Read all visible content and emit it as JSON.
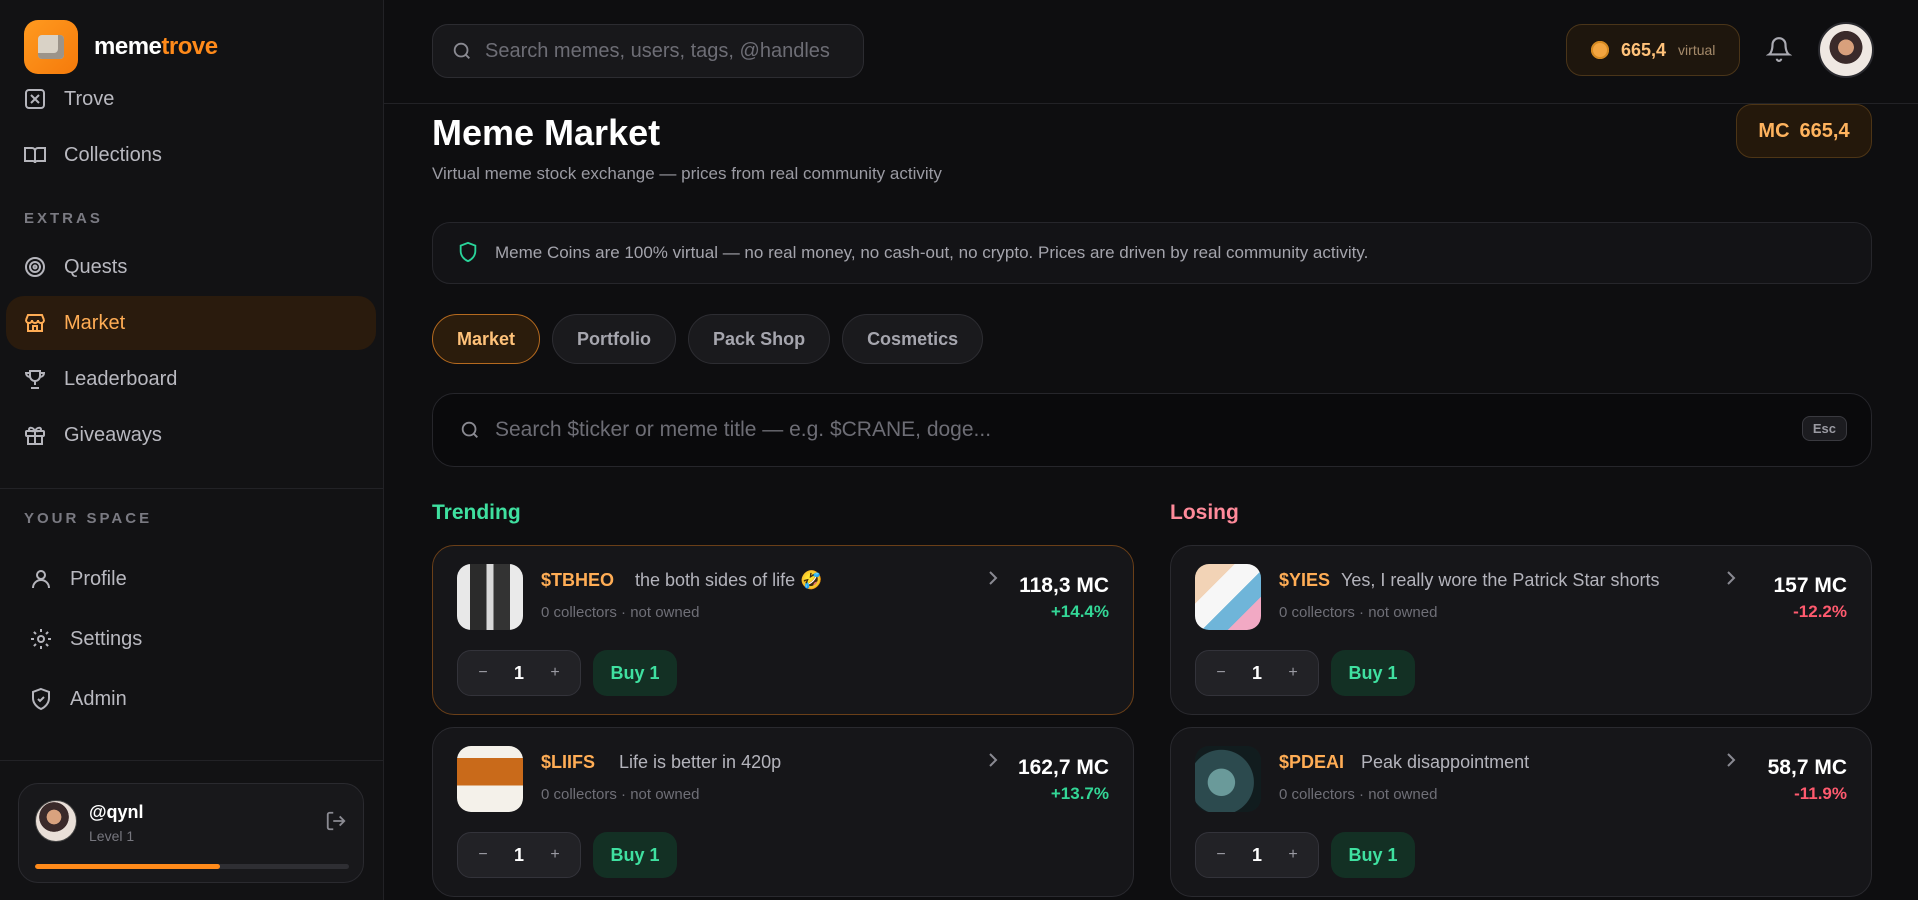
{
  "brand": {
    "name_a": "meme",
    "name_b": "trove"
  },
  "sidebar": {
    "items": [
      {
        "label": "Trove"
      },
      {
        "label": "Collections"
      }
    ],
    "extras_label": "EXTRAS",
    "extras": [
      {
        "label": "Quests"
      },
      {
        "label": "Market"
      },
      {
        "label": "Leaderboard"
      },
      {
        "label": "Giveaways"
      }
    ],
    "space_label": "YOUR SPACE",
    "space": [
      {
        "label": "Profile"
      },
      {
        "label": "Settings"
      },
      {
        "label": "Admin"
      }
    ]
  },
  "user": {
    "handle": "@qynl",
    "level": "Level 1",
    "xp_fraction": 0.59
  },
  "topbar": {
    "search_placeholder": "Search memes, users, tags, @handles",
    "coins": "665,4",
    "coins_tag": "virtual"
  },
  "page": {
    "title": "Meme Market",
    "subtitle": "Virtual meme stock exchange — prices from real community activity",
    "mc_label": "MC",
    "mc_value": "665,4",
    "notice": "Meme Coins are 100% virtual — no real money, no cash-out, no crypto. Prices are driven by real community activity."
  },
  "tabs": [
    {
      "label": "Market"
    },
    {
      "label": "Portfolio"
    },
    {
      "label": "Pack Shop"
    },
    {
      "label": "Cosmetics"
    }
  ],
  "search": {
    "placeholder": "Search $ticker or meme title — e.g. $CRANE, doge...",
    "esc": "Esc"
  },
  "trending": {
    "title": "Trending",
    "cards": [
      {
        "ticker": "$TBHEO",
        "title": "the both sides of life 🤣",
        "meta": "0 collectors · not owned",
        "price": "118,3 MC",
        "change": "+14.4%",
        "qty": "1",
        "buy": "Buy 1"
      },
      {
        "ticker": "$LIIFS",
        "title": "Life is better in 420p",
        "meta": "0 collectors · not owned",
        "price": "162,7 MC",
        "change": "+13.7%",
        "qty": "1",
        "buy": "Buy 1"
      }
    ]
  },
  "losing": {
    "title": "Losing",
    "cards": [
      {
        "ticker": "$YIES",
        "title": "Yes, I really wore the Patrick Star shorts",
        "meta": "0 collectors · not owned",
        "price": "157 MC",
        "change": "-12.2%",
        "qty": "1",
        "buy": "Buy 1"
      },
      {
        "ticker": "$PDEAI",
        "title": "Peak disappointment",
        "meta": "0 collectors · not owned",
        "price": "58,7 MC",
        "change": "-11.9%",
        "qty": "1",
        "buy": "Buy 1"
      }
    ]
  },
  "stepper": {
    "minus": "−",
    "plus": "+"
  }
}
